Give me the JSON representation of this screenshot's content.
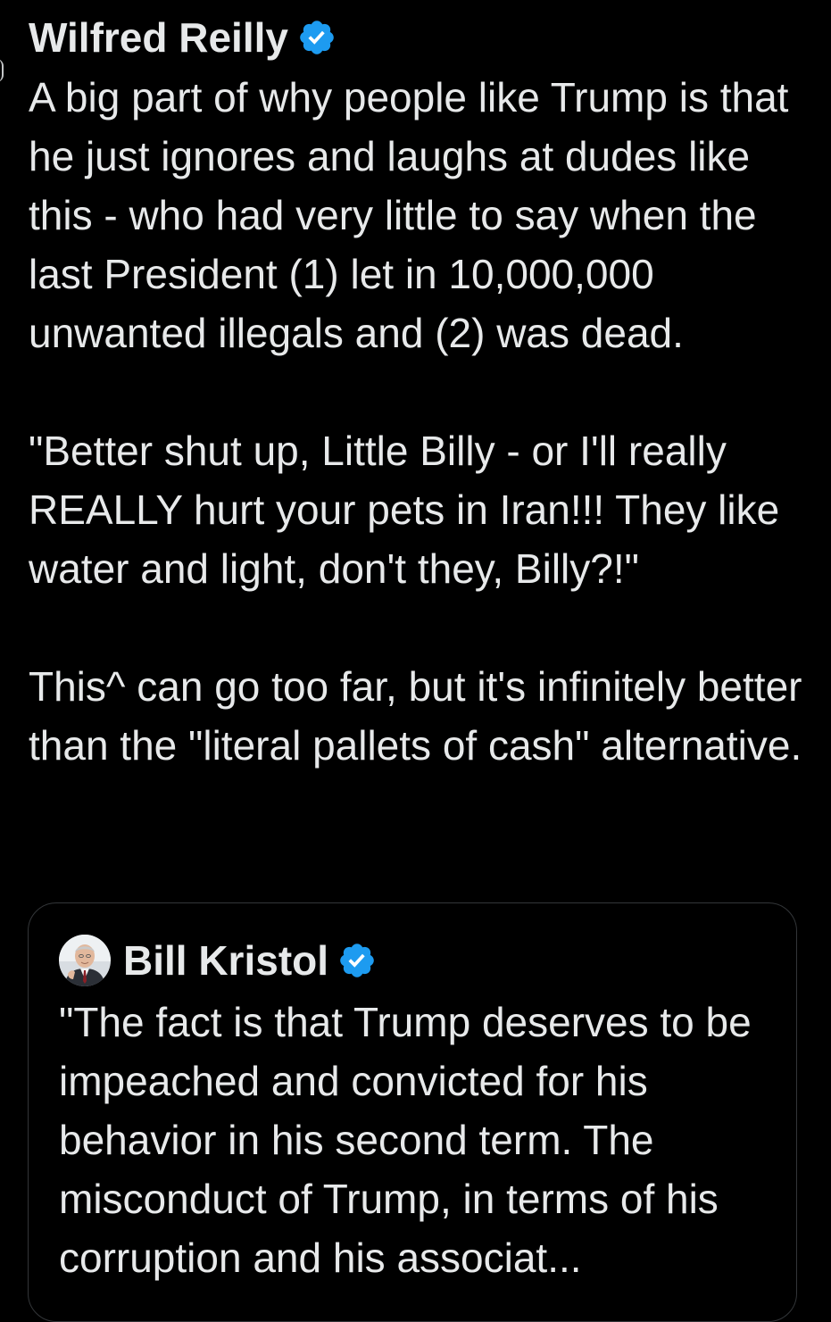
{
  "colors": {
    "background": "#000000",
    "text": "#e7e9ea",
    "verified_badge": "#1d9bf0",
    "card_border": "#333639"
  },
  "tweet": {
    "author_name": "Wilfred Reilly",
    "verified_icon": "verified-badge-icon",
    "paragraphs": [
      "A big part of why people like Trump is that he just ignores and laughs at dudes like this - who had very little to say when the last President (1) let in 10,000,000 unwanted illegals and (2) was dead.",
      "\"Better shut up, Little Billy - or I'll really REALLY hurt your pets in Iran!!! They like water and light, don't they, Billy?!\"",
      "This^ can go too far, but it's infinitely better than the \"literal pallets of cash\" alternative."
    ]
  },
  "quoted_tweet": {
    "author_name": "Bill Kristol",
    "avatar_icon": "profile-avatar",
    "verified_icon": "verified-badge-icon",
    "text": "\"The fact is that Trump deserves to be impeached and convicted for his behavior in his second term. The misconduct of Trump, in terms of his corruption and his associat..."
  }
}
